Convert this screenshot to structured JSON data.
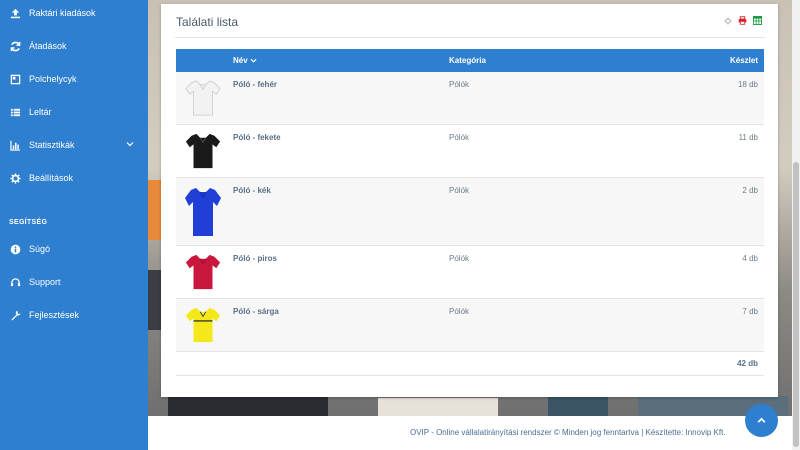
{
  "sidebar": {
    "items": [
      {
        "label": "Raktári kiadások",
        "icon": "upload-icon"
      },
      {
        "label": "Átadások",
        "icon": "refresh-icon"
      },
      {
        "label": "Polchelycyk",
        "icon": "box-icon"
      },
      {
        "label": "Leltár",
        "icon": "list-icon"
      },
      {
        "label": "Statisztikák",
        "icon": "bar-chart-icon"
      },
      {
        "label": "Beállítások",
        "icon": "gear-icon"
      }
    ],
    "section_title": "SEGÍTSÉG",
    "help_items": [
      {
        "label": "Súgó",
        "icon": "info-icon"
      },
      {
        "label": "Support",
        "icon": "headset-icon"
      },
      {
        "label": "Fejlesztések",
        "icon": "wrench-icon"
      }
    ]
  },
  "card": {
    "title": "Találati lista"
  },
  "table": {
    "headers": {
      "name": "Név",
      "category": "Kategória",
      "stock": "Készlet"
    },
    "rows": [
      {
        "name": "Póló - fehér",
        "category": "Pólók",
        "stock": "18 db",
        "color": "#f2f2f2"
      },
      {
        "name": "Póló - fekete",
        "category": "Pólók",
        "stock": "11 db",
        "color": "#1a1a1a"
      },
      {
        "name": "Póló - kék",
        "category": "Pólók",
        "stock": "2 db",
        "color": "#1f3fd6"
      },
      {
        "name": "Póló - piros",
        "category": "Pólók",
        "stock": "4 db",
        "color": "#c8163c"
      },
      {
        "name": "Póló - sárga",
        "category": "Pólók",
        "stock": "7 db",
        "color": "#f4e81a"
      }
    ],
    "total": "42 db"
  },
  "footer": {
    "text": "OVIP - Online vállalatirányítási rendszer © Minden jog fenntartva | Készítette: Innovip Kft."
  },
  "colors": {
    "accent": "#2f7fd0"
  }
}
